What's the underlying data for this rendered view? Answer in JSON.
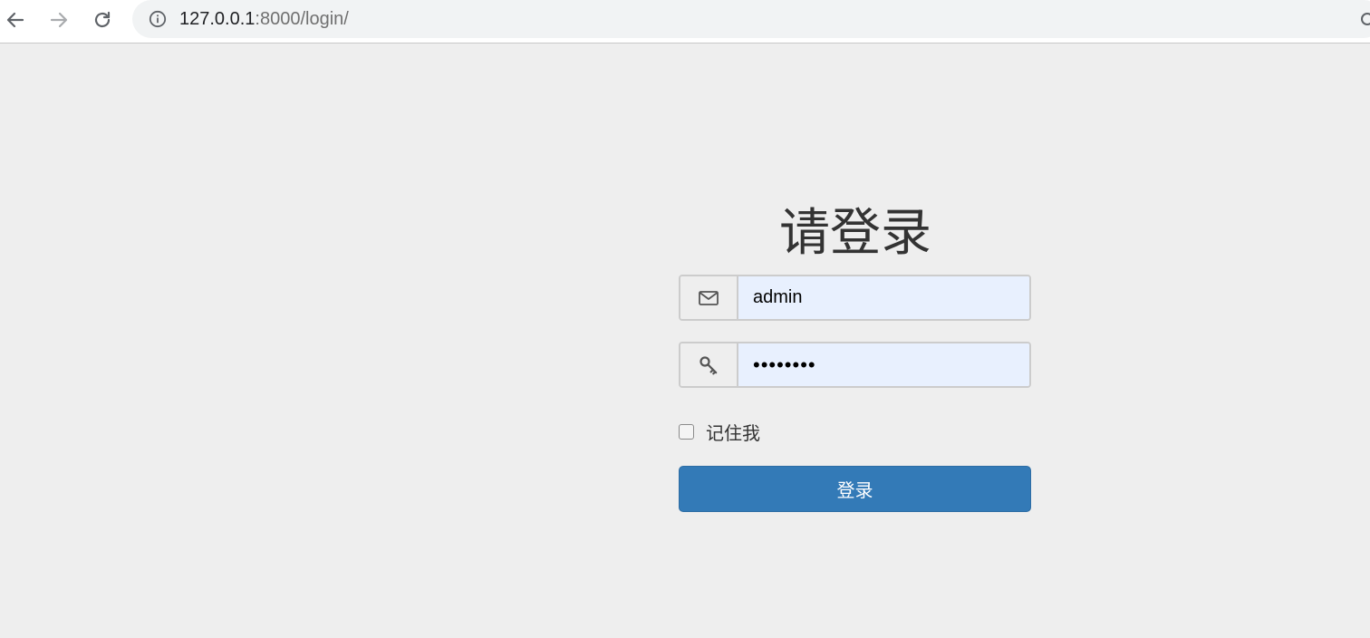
{
  "browser": {
    "url_host": "127.0.0.1",
    "url_rest": ":8000/login/",
    "icons": [
      "back-arrow-icon",
      "forward-arrow-icon",
      "reload-icon",
      "info-icon"
    ]
  },
  "login": {
    "title": "请登录",
    "username_value": "admin",
    "password_value": "••••••••",
    "remember_label": "记住我",
    "submit_label": "登录",
    "icons": [
      "envelope-icon",
      "key-icon"
    ]
  },
  "colors": {
    "page_bg": "#eeeeee",
    "input_autofill_bg": "#e8f0fe",
    "primary_button": "#337ab7"
  }
}
